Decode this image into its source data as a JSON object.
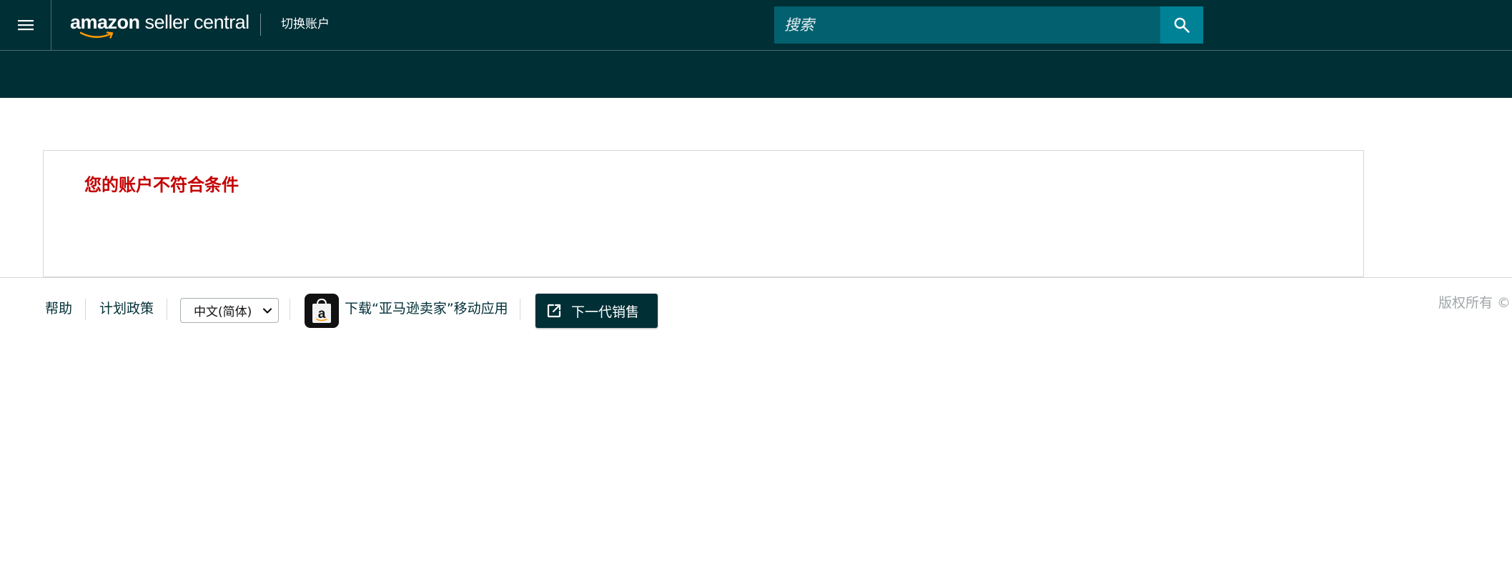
{
  "header": {
    "logo_primary": "amazon",
    "logo_secondary": " seller central",
    "switch_account_label": "切换账户",
    "search": {
      "placeholder": "搜索",
      "value": ""
    }
  },
  "main": {
    "title": "您的账户不符合条件"
  },
  "footer": {
    "help_label": "帮助",
    "policies_label": "计划政策",
    "language": {
      "selected": "中文(简体)"
    },
    "app_download_label": "下载“亚马逊卖家”移动应用",
    "next_gen_button_label": "下一代销售",
    "copyright": "版权所有 ©"
  },
  "colors": {
    "header_bg": "#002f36",
    "search_bg": "#02606f",
    "search_button_bg": "#008296",
    "title_red": "#c40000",
    "link_text": "#002f36"
  },
  "icons": {
    "menu": "hamburger-menu-icon",
    "search": "search-icon",
    "app": "amazon-shopping-bag-app-icon",
    "external": "external-link-icon",
    "dropdown": "chevron-down-icon"
  }
}
